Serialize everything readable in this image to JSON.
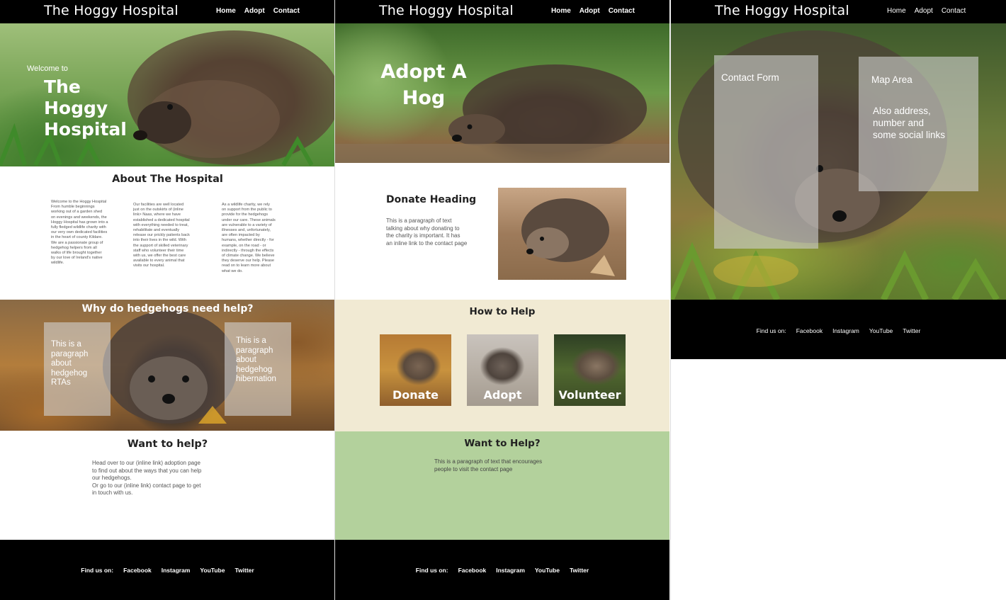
{
  "site": {
    "logo": "The Hoggy Hospital",
    "nav": [
      "Home",
      "Adopt",
      "Contact"
    ]
  },
  "footer": {
    "find_us": "Find us on:",
    "links": [
      "Facebook",
      "Instagram",
      "YouTube",
      "Twitter"
    ]
  },
  "home": {
    "hero_welcome": "Welcome to",
    "hero_title_lines": [
      "The",
      "Hoggy",
      "Hospital"
    ],
    "about_heading": "About The Hospital",
    "about_columns": [
      [
        "Welcome to the Hoggy Hospital",
        "From humble beginnings",
        "working out of a garden shed",
        "on evenings and weekends, the",
        "Hoggy Hospital has grown into a",
        "fully fledged wildlife charity with",
        "our very own dedicated facilities",
        "in the heart of county Kildare.",
        "We are a passionate group of",
        "hedgehog helpers from all",
        "walks of life brought together",
        "by our love of Ireland's native",
        "wildlife."
      ],
      [
        "Our facilities are well located",
        "just on the outskirts of (inline",
        "link> Naas, where we have",
        "established a dedicated hospital",
        "with everything needed to treat,",
        "rehabilitate and eventually",
        "release our prickly patients back",
        "into their lives in the wild. With",
        "the support of skilled veterinary",
        "staff who volunteer their time",
        "with us, we offer the best care",
        "available to every animal that",
        "visits our hospital."
      ],
      [
        "As a wildlife charity, we rely",
        "on support from the public to",
        "provide for the hedgehogs",
        "under our care. These animals",
        "are vulnerable to a variety of",
        "illnesses and, unfortunately,",
        "are often impacted by",
        "humans, whether directly - for",
        "example, on the road - or",
        "indirectly - through the effects",
        "of climate change. We believe",
        "they deserve our help. Please",
        "read on to learn more about",
        "what we do."
      ]
    ],
    "why_heading": "Why do hedgehogs need help?",
    "why_left_lines": [
      "This is a",
      "paragraph",
      "about",
      "hedgehog",
      "RTAs"
    ],
    "why_right_lines": [
      "This is a",
      "paragraph",
      "about",
      "hedgehog",
      "hibernation"
    ],
    "want_heading": "Want to help?",
    "want_lines": [
      "Head over to our (inline link) adoption page",
      "to find out about the ways that you can help",
      "our hedgehogs.",
      "Or go to our (inline link) contact page to get",
      "in touch with us."
    ]
  },
  "adopt": {
    "hero_title_lines": [
      "Adopt A",
      "Hog"
    ],
    "donate_heading": "Donate Heading",
    "donate_lines": [
      "This is a paragraph of text",
      "talking about why donating to",
      "the charity is important. It has",
      "an inline link to the contact page"
    ],
    "how_heading": "How to Help",
    "cards": [
      "Donate",
      "Adopt",
      "Volunteer"
    ],
    "want_heading": "Want to Help?",
    "want_lines": [
      "This is a paragraph of text that encourages",
      "people to visit the contact page"
    ]
  },
  "contact": {
    "form_label": "Contact Form",
    "map_label": "Map Area",
    "map_lines": [
      "Also address,",
      "number and",
      "some social links"
    ]
  }
}
